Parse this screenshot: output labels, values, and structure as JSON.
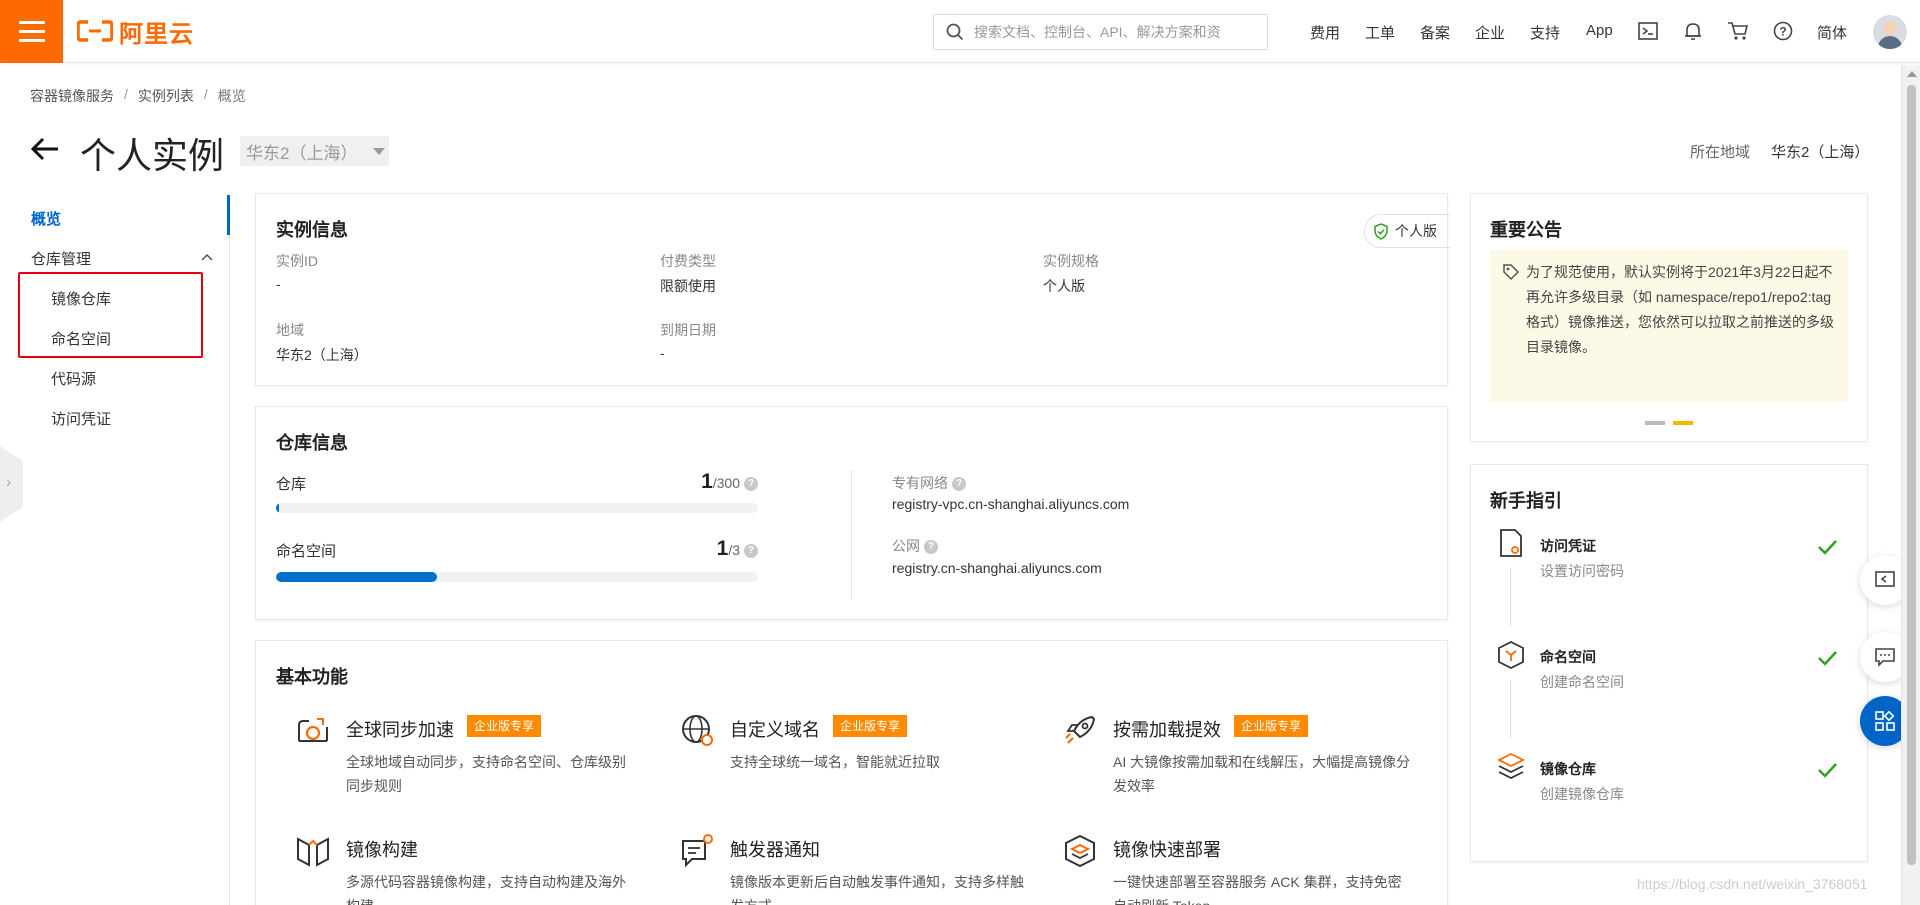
{
  "header": {
    "logo_text": "阿里云",
    "search_placeholder": "搜索文档、控制台、API、解决方案和资",
    "nav": [
      "费用",
      "工单",
      "备案",
      "企业",
      "支持",
      "App"
    ],
    "lang": "简体",
    "icons": [
      "terminal-icon",
      "bell-icon",
      "cart-icon",
      "help-icon"
    ]
  },
  "breadcrumb": [
    "容器镜像服务",
    "实例列表",
    "概览"
  ],
  "page": {
    "title": "个人实例",
    "region_select": "华东2（上海）",
    "region_label": "所在地域",
    "region_value": "华东2（上海）"
  },
  "sidebar": {
    "overview": "概览",
    "repo_mgmt": "仓库管理",
    "items": [
      "镜像仓库",
      "命名空间",
      "代码源",
      "访问凭证"
    ]
  },
  "instance_info": {
    "title": "实例信息",
    "badge": "个人版",
    "fields": [
      {
        "label": "实例ID",
        "value": "-"
      },
      {
        "label": "付费类型",
        "value": "限额使用"
      },
      {
        "label": "实例规格",
        "value": "个人版"
      },
      {
        "label": "地域",
        "value": "华东2（上海）"
      },
      {
        "label": "到期日期",
        "value": "-"
      }
    ]
  },
  "repo_info": {
    "title": "仓库信息",
    "repo": {
      "label": "仓库",
      "used": "1",
      "total": "/300",
      "fraction": 0.0033
    },
    "namespace": {
      "label": "命名空间",
      "used": "1",
      "total": "/3",
      "fraction": 0.3333
    },
    "vpc": {
      "label": "专有网络",
      "value": "registry-vpc.cn-shanghai.aliyuncs.com"
    },
    "public": {
      "label": "公网",
      "value": "registry.cn-shanghai.aliyuncs.com"
    }
  },
  "features": {
    "title": "基本功能",
    "items": [
      {
        "title": "全球同步加速",
        "tag": "企业版专享",
        "desc": "全球地域自动同步，支持命名空间、仓库级别同步规则",
        "icon": "global-sync-icon"
      },
      {
        "title": "自定义域名",
        "tag": "企业版专享",
        "desc": "支持全球统一域名，智能就近拉取",
        "icon": "custom-domain-icon"
      },
      {
        "title": "按需加载提效",
        "tag": "企业版专享",
        "desc": "AI 大镜像按需加载和在线解压，大幅提高镜像分发效率",
        "icon": "rocket-icon"
      },
      {
        "title": "镜像构建",
        "tag": "",
        "desc": "多源代码容器镜像构建，支持自动构建及海外构建",
        "icon": "image-build-icon"
      },
      {
        "title": "触发器通知",
        "tag": "",
        "desc": "镜像版本更新后自动触发事件通知，支持多样触发方式",
        "icon": "trigger-icon"
      },
      {
        "title": "镜像快速部署",
        "tag": "",
        "desc": "一键快速部署至容器服务 ACK 集群，支持免密自动刷新 Token",
        "icon": "deploy-icon"
      }
    ]
  },
  "notice": {
    "title": "重要公告",
    "text": "为了规范使用，默认实例将于2021年3月22日起不再允许多级目录（如 namespace/repo1/repo2:tag 格式）镜像推送，您依然可以拉取之前推送的多级目录镜像。"
  },
  "guide": {
    "title": "新手指引",
    "steps": [
      {
        "title": "访问凭证",
        "desc": "设置访问密码"
      },
      {
        "title": "命名空间",
        "desc": "创建命名空间"
      },
      {
        "title": "镜像仓库",
        "desc": "创建镜像仓库"
      }
    ]
  },
  "watermark": "https://blog.csdn.net/weixin_3768051",
  "colors": {
    "brand": "#ff6a00",
    "primary": "#0064c8",
    "tag": "#ff8a00",
    "check": "#2ea121",
    "highlight_box": "#e60012"
  }
}
